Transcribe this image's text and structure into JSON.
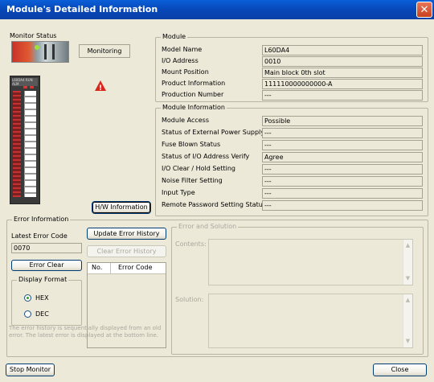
{
  "window": {
    "title": "Module's Detailed Information",
    "close_glyph": "✕"
  },
  "monitor": {
    "group_label": "Monitor Status",
    "status_text": "Monitoring",
    "warning_glyph": "!",
    "device_header": "L60DA4",
    "device_header_right": "RUN ALM",
    "hw_button": "H/W Information",
    "hw_button_underline": "I"
  },
  "module": {
    "group_label": "Module",
    "rows": [
      {
        "label": "Model Name",
        "value": "L60DA4"
      },
      {
        "label": "I/O Address",
        "value": "0010"
      },
      {
        "label": "Mount Position",
        "value": "Main block 0th slot"
      },
      {
        "label": "Product Information",
        "value": "111110000000000-A"
      },
      {
        "label": "Production Number",
        "value": "---"
      }
    ]
  },
  "module_info": {
    "group_label": "Module Information",
    "rows": [
      {
        "label": "Module Access",
        "value": "Possible"
      },
      {
        "label": "Status of External Power Supply",
        "value": "---"
      },
      {
        "label": "Fuse Blown Status",
        "value": "---"
      },
      {
        "label": "Status of I/O Address Verify",
        "value": "Agree"
      },
      {
        "label": "I/O Clear / Hold Setting",
        "value": "---"
      },
      {
        "label": "Noise Filter Setting",
        "value": "---"
      },
      {
        "label": "Input Type",
        "value": "---"
      },
      {
        "label": "Remote Password Setting Status",
        "value": "---"
      }
    ]
  },
  "error_info": {
    "group_label": "Error Information",
    "latest_label": "Latest Error Code",
    "latest_value": "0070",
    "update_button": "Update Error History",
    "clear_history_button": "Clear Error History",
    "error_clear_button": "Error Clear",
    "table_headers": [
      "No.",
      "Error Code"
    ],
    "display_format_label": "Display Format",
    "hex_label": "HEX",
    "dec_label": "DEC",
    "note": "The error history is sequentially displayed from an old error. The latest error is displayed at the bottom line."
  },
  "error_solution": {
    "group_label": "Error and Solution",
    "contents_label": "Contents:",
    "solution_label": "Solution:"
  },
  "footer": {
    "stop_monitor": "Stop Monitor",
    "close": "Close"
  },
  "colors": {
    "titlebar": "#0747b8",
    "warning": "#d8261b",
    "device_body": "#3a3a3a"
  }
}
